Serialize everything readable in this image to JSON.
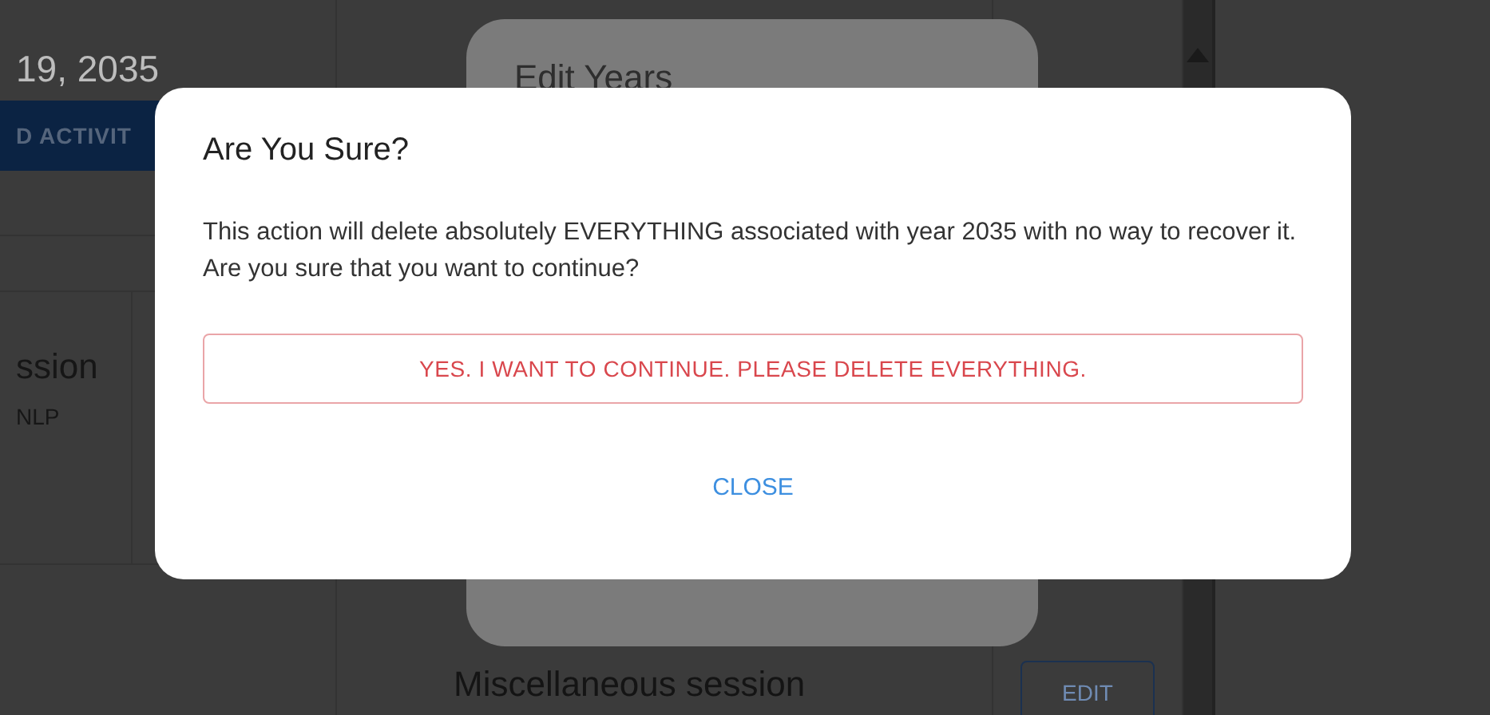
{
  "background": {
    "date": "19, 2035",
    "add_button": "D ACTIVIT",
    "session": {
      "title": "ssion",
      "subtitle": "NLP"
    },
    "misc_session": {
      "title": "Miscellaneous session",
      "edit_button": "EDIT"
    }
  },
  "edit_years_dialog": {
    "title": "Edit Years"
  },
  "confirm_dialog": {
    "title": "Are You Sure?",
    "message": "This action will delete absolutely EVERYTHING associated with year 2035 with no way to recover it. Are you sure that you want to continue?",
    "confirm_button": "YES. I WANT TO CONTINUE. PLEASE DELETE EVERYTHING.",
    "close_button": "CLOSE"
  }
}
